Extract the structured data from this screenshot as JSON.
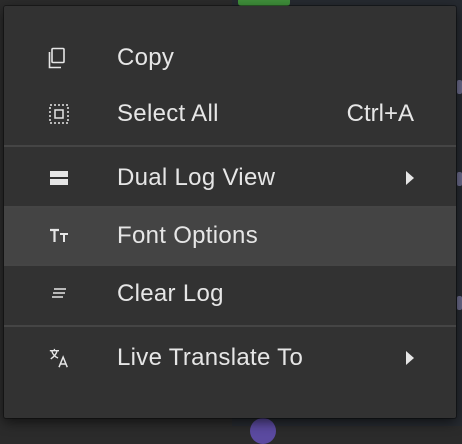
{
  "menu": {
    "items": [
      {
        "label": "Copy",
        "shortcut": "",
        "icon": "copy-icon"
      },
      {
        "label": "Select All",
        "shortcut": "Ctrl+A",
        "icon": "select-all-icon"
      },
      {
        "label": "Dual Log View",
        "submenu": true,
        "icon": "dual-view-icon"
      },
      {
        "label": "Font Options",
        "icon": "font-icon"
      },
      {
        "label": "Clear Log",
        "icon": "clear-icon"
      },
      {
        "label": "Live Translate To",
        "submenu": true,
        "icon": "translate-icon"
      }
    ]
  },
  "colors": {
    "menu_bg": "#323232",
    "highlight_bg": "#444444",
    "text": "#e6e6e6",
    "separator": "#454545"
  }
}
